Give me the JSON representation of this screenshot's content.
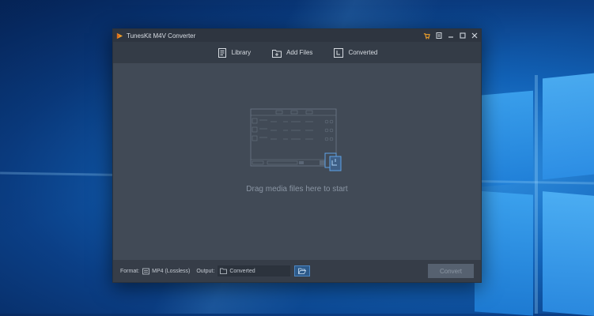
{
  "window": {
    "title": "TunesKit M4V Converter"
  },
  "toolbar": {
    "items": [
      {
        "label": "Library",
        "icon": "library-icon"
      },
      {
        "label": "Add Files",
        "icon": "add-files-icon"
      },
      {
        "label": "Converted",
        "icon": "converted-icon"
      }
    ]
  },
  "main": {
    "drop_hint": "Drag media files here to start"
  },
  "bottom": {
    "format_label": "Format:",
    "format_value": "MP4 (Lossless)",
    "output_label": "Output:",
    "output_value": "Converted",
    "convert_label": "Convert"
  },
  "colors": {
    "window_bg": "#414a56",
    "titlebar_bg": "#2e3540",
    "accent_blue": "#4b86c3",
    "cart_orange": "#f1a12a"
  }
}
